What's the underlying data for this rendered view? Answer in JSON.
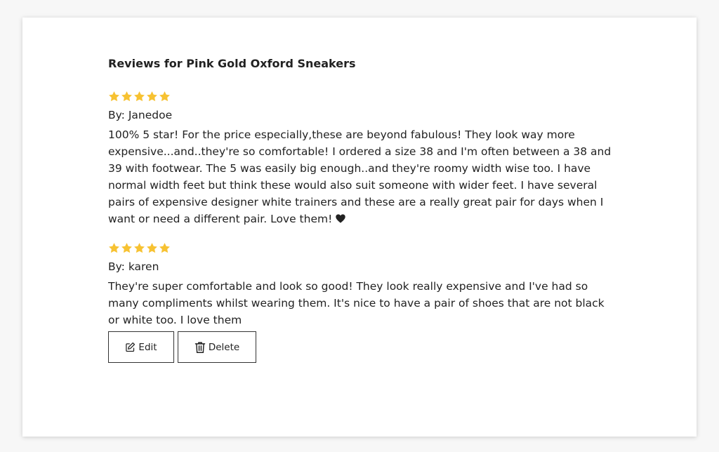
{
  "page": {
    "title": "Reviews for Pink Gold Oxford Sneakers"
  },
  "colors": {
    "star": "#f7c232",
    "text": "#222222",
    "background": "#f7f7f7",
    "card": "#ffffff"
  },
  "reviews": [
    {
      "rating": 5,
      "author": "By: Janedoe",
      "text": "100% 5 star! For the price especially,these are beyond fabulous! They look way more expensive...and..they're so comfortable! I ordered a size 38 and I'm often between a 38 and 39 with footwear. The 5 was easily big enough..and they're roomy width wise too. I have normal width feet but think these would also suit someone with wider feet. I have several pairs of expensive designer white trainers and these are a really great pair for days when I want or need a different pair. Love them!",
      "trailing_icon": "heart-icon"
    },
    {
      "rating": 5,
      "author": "By: karen",
      "text": "They're super comfortable and look so good! They look really expensive and I've had so many compliments whilst wearing them. It's nice to have a pair of shoes that are not black or white too. I love them"
    }
  ],
  "actions": {
    "edit_label": "Edit",
    "edit_icon": "edit-icon",
    "delete_label": "Delete",
    "delete_icon": "trash-icon"
  }
}
